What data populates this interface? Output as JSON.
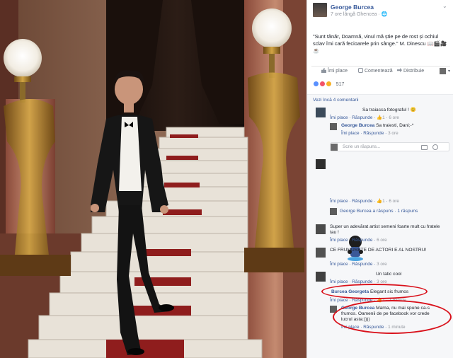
{
  "post": {
    "author": "George Burcea",
    "meta": "7 ore lângă Ghencea · ",
    "text": "\"Sunt tânăr, Doamnă, vinul mă știe pe de rost și ochiul sclav îmi cară fecioarele prin sânge.\" M. Dinescu 📖🎬🎥☕",
    "menu_icon": "chevron-down-icon"
  },
  "actions": {
    "like": "Îmi place",
    "comment": "Comentează",
    "share": "Distribuie"
  },
  "reactions": {
    "count": "517",
    "colors": [
      "#5890ff",
      "#f25268",
      "#f7b125"
    ]
  },
  "comments_header": "Vezi încă 4 comentarii",
  "comments": [
    {
      "name": "",
      "text": "Sa traiasca fotograful ! 😊",
      "like": "Îmi place",
      "reply": "Răspunde",
      "likes": "1",
      "time": "6 ore"
    },
    {
      "name": "George Burcea",
      "text": "Sa traiesti, Dani;-*",
      "like": "Îmi place",
      "reply": "Răspunde",
      "time": "3 ore"
    },
    {
      "name": "",
      "text": "",
      "like": "Îmi place",
      "reply": "Răspunde",
      "likes": "1",
      "time": "6 ore"
    },
    {
      "name": "",
      "text": "Super un adevărat artist semeni foarte mult cu fratele tau !",
      "like": "Îmi place",
      "reply": "Răspunde",
      "time": "6 ore"
    },
    {
      "name": "",
      "text": "CE FRUMUSETE DE ACTORI E AL NOSTRU!",
      "like": "Îmi place",
      "reply": "Răspunde",
      "time": "3 ore"
    },
    {
      "name": "",
      "text": "Un tatic cool",
      "like": "Îmi place",
      "reply": "Răspunde",
      "time": "3 ore"
    },
    {
      "name": "Burcea Georgeta",
      "text": "Elegant sic frumos",
      "like": "Îmi place",
      "reply": "Răspunde",
      "likes": "1",
      "time": "1 minute"
    },
    {
      "name": "George Burcea",
      "text": "Mama, nu mai spune ca-s frumos. Oamenii de pe facebook vor crede lucrul asta:))))",
      "like": "Îmi place",
      "reply": "Răspunde",
      "time": "1 minute"
    }
  ],
  "reply_input": {
    "placeholder": "Scrie un răspuns..."
  },
  "reply_summary": {
    "text": "George Burcea a răspuns · 1 răspuns"
  },
  "highlight_color": "#d9101a"
}
